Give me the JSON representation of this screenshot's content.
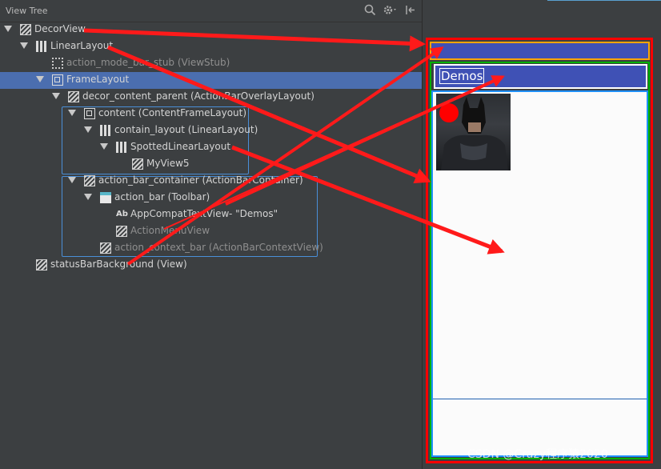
{
  "panel": {
    "title": "View Tree"
  },
  "tree": [
    {
      "label": "DecorView",
      "extra": "",
      "icon": "hatch-view-icon",
      "dim": false
    },
    {
      "label": "LinearLayout",
      "extra": "",
      "icon": "linear-layout-icon",
      "dim": false
    },
    {
      "label": "action_mode_bar_stub (ViewStub)",
      "extra": "",
      "icon": "viewstub-icon",
      "dim": true
    },
    {
      "label": "FrameLayout",
      "extra": "",
      "icon": "frame-layout-icon",
      "dim": false,
      "selected": true
    },
    {
      "label": "decor_content_parent (ActionBarOverlayLayout)",
      "extra": "",
      "icon": "hatch-view-icon",
      "dim": false
    },
    {
      "label": "content (ContentFrameLayout)",
      "extra": "",
      "icon": "frame-layout-icon",
      "dim": false
    },
    {
      "label": "contain_layout (LinearLayout)",
      "extra": "",
      "icon": "linear-layout-icon",
      "dim": false
    },
    {
      "label": "SpottedLinearLayout",
      "extra": "",
      "icon": "linear-layout-icon",
      "dim": false
    },
    {
      "label": "MyView5",
      "extra": "",
      "icon": "hatch-view-icon",
      "dim": false
    },
    {
      "label": "action_bar_container (ActionBarContainer)",
      "extra": "",
      "icon": "hatch-view-icon",
      "dim": false
    },
    {
      "label": "action_bar (Toolbar)",
      "extra": "",
      "icon": "toolbar-icon",
      "dim": false
    },
    {
      "label": "AppCompatTextView",
      "extra": " - \"Demos\"",
      "icon": "text-view-icon",
      "dim": false
    },
    {
      "label": "ActionMenuView",
      "extra": "",
      "icon": "hatch-view-icon",
      "dim": true
    },
    {
      "label": "action_context_bar (ActionBarContextView)",
      "extra": "",
      "icon": "hatch-view-icon",
      "dim": true
    },
    {
      "label": "statusBarBackground (View)",
      "extra": "",
      "icon": "hatch-view-icon",
      "dim": false
    }
  ],
  "preview": {
    "toolbar_title": "Demos"
  },
  "watermark": "CSDN @Crazy程序猿2020",
  "colors": {
    "highlight_red": "#ff0000",
    "toolbar_blue": "#3f51b5",
    "outline_green": "#00b000",
    "outline_cyan": "#1e90ff",
    "status_orange": "#ffa500",
    "selection": "#4b6eaf"
  }
}
